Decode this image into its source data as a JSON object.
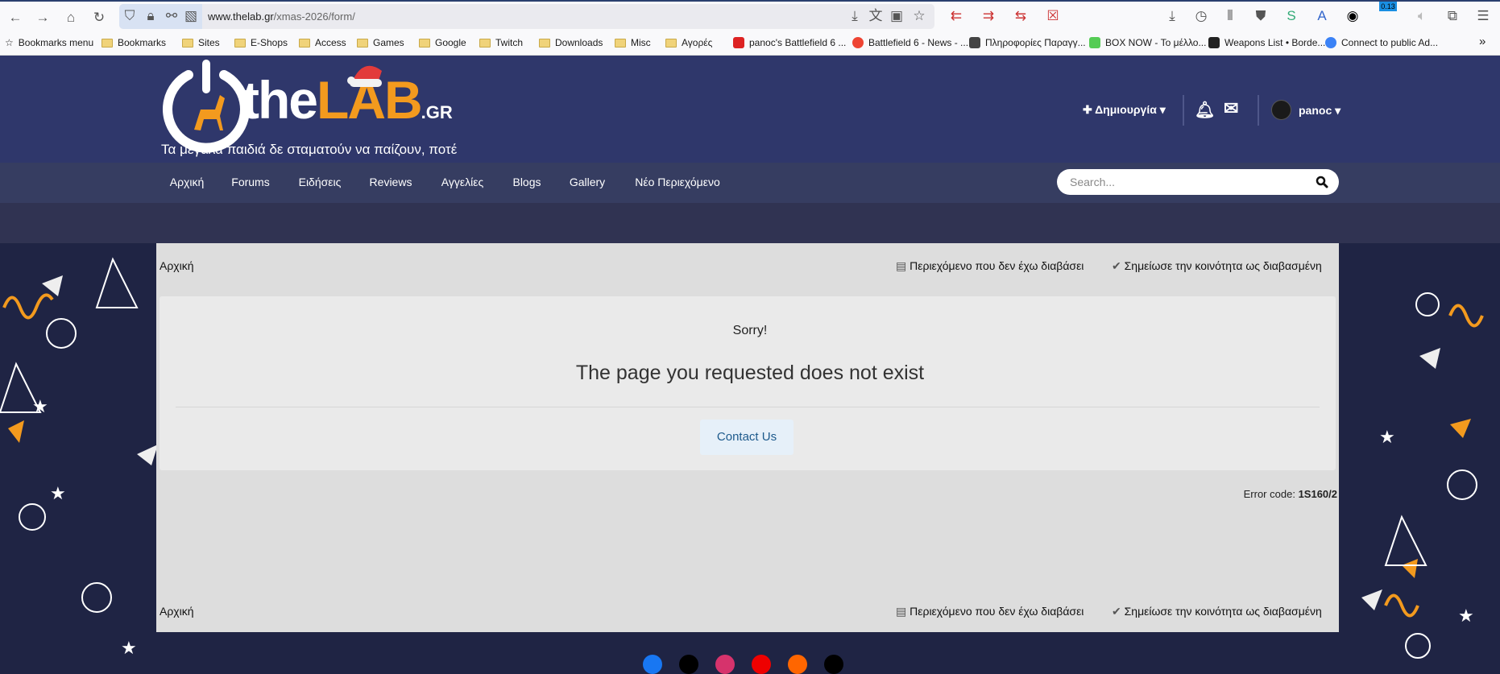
{
  "browser": {
    "url_domain": "www.thelab.gr",
    "url_path": "/xmas-2026/form/",
    "extension_badge": "0.13",
    "bookmarks": [
      {
        "label": "Bookmarks menu",
        "type": "menu"
      },
      {
        "label": "Bookmarks",
        "type": "folder"
      },
      {
        "label": "Sites",
        "type": "folder"
      },
      {
        "label": "E-Shops",
        "type": "folder"
      },
      {
        "label": "Access",
        "type": "folder"
      },
      {
        "label": "Games",
        "type": "folder"
      },
      {
        "label": "Google",
        "type": "folder"
      },
      {
        "label": "Twitch",
        "type": "folder"
      },
      {
        "label": "Downloads",
        "type": "folder"
      },
      {
        "label": "Misc",
        "type": "folder"
      },
      {
        "label": "Αγορές",
        "type": "folder"
      },
      {
        "label": "panoc's Battlefield 6 ...",
        "type": "link"
      },
      {
        "label": "Battlefield 6 - News - ...",
        "type": "link"
      },
      {
        "label": "Πληροφορίες Παραγγ...",
        "type": "link"
      },
      {
        "label": "BOX NOW - Το μέλλο...",
        "type": "link"
      },
      {
        "label": "Weapons List • Borde...",
        "type": "link"
      },
      {
        "label": "Connect to public Ad...",
        "type": "link"
      }
    ]
  },
  "site": {
    "logo_the": "the",
    "logo_lab": "LAB",
    "logo_gr": ".GR",
    "tagline": "Τα μεγάλα παιδιά δε σταματούν να παίζουν, ποτέ",
    "create_label": "Δημιουργία",
    "username": "panoc",
    "nav": [
      "Αρχική",
      "Forums",
      "Ειδήσεις",
      "Reviews",
      "Αγγελίες",
      "Blogs",
      "Gallery",
      "Νέο Περιεχόμενο"
    ],
    "search_placeholder": "Search..."
  },
  "content": {
    "breadcrumb": "Αρχική",
    "unread_label": "Περιεχόμενο που δεν έχω διαβάσει",
    "mark_read_label": "Σημείωσε την κοινότητα ως διαβασμένη",
    "sorry": "Sorry!",
    "title": "The page you requested does not exist",
    "contact": "Contact Us",
    "error_code_label": "Error code:",
    "error_code": "1S160/2"
  }
}
